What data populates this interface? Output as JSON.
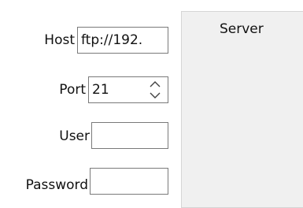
{
  "form": {
    "host_label": "Host",
    "host_value": "ftp://192.",
    "port_label": "Port",
    "port_value": "21",
    "user_label": "User",
    "user_value": "",
    "password_label": "Password",
    "password_value": ""
  },
  "panel": {
    "title": "Server"
  },
  "icons": {
    "spin_up": "chevron-up-icon",
    "spin_down": "chevron-down-icon"
  }
}
